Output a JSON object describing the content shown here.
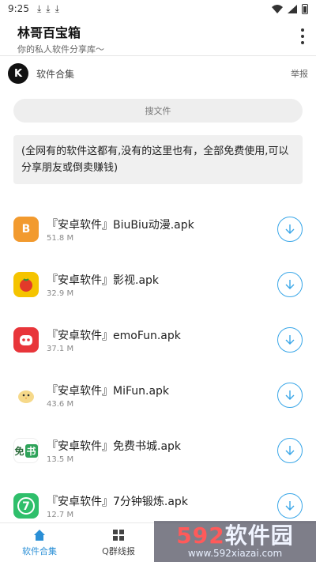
{
  "status": {
    "time": "9:25",
    "download_glyph": "⤓"
  },
  "app": {
    "title": "林哥百宝箱",
    "subtitle": "你的私人软件分享库〜"
  },
  "header": {
    "logo_letter": "K",
    "section_name": "软件合集",
    "report": "举报"
  },
  "search": {
    "placeholder": "搜文件"
  },
  "notice": "(全网有的软件这都有,没有的这里也有，全部免费使用,可以分享朋友或倒卖赚钱)",
  "items": [
    {
      "name": "『安卓软件』BiuBiu动漫.apk",
      "size": "51.8 M",
      "icon": "anime-girl-icon",
      "color": "#f29a2e",
      "glyph": "B"
    },
    {
      "name": "『安卓软件』影视.apk",
      "size": "32.9 M",
      "icon": "tomato-icon",
      "color": "#f5c400",
      "glyph": "●"
    },
    {
      "name": "『安卓软件』emoFun.apk",
      "size": "37.1 M",
      "icon": "emo-face-icon",
      "color": "#e8353a",
      "glyph": "◕"
    },
    {
      "name": "『安卓软件』MiFun.apk",
      "size": "43.6 M",
      "icon": "chick-icon",
      "color": "#f7e3a8",
      "glyph": "◔"
    },
    {
      "name": "『安卓软件』免费书城.apk",
      "size": "13.5 M",
      "icon": "bookstore-icon",
      "color": "#ffffff",
      "glyph": "书"
    },
    {
      "name": "『安卓软件』7分钟锻炼.apk",
      "size": "12.7 M",
      "icon": "seven-icon",
      "color": "#2fbf6b",
      "glyph": "7"
    }
  ],
  "nav": [
    {
      "label": "软件合集",
      "icon": "home-icon",
      "active": true
    },
    {
      "label": "Q群线报",
      "icon": "grid-icon",
      "active": false
    }
  ],
  "watermark": {
    "title_num": "592",
    "title_text": "软件园",
    "url": "www.592xiazai.com"
  },
  "colors": {
    "accent": "#2a8fd6",
    "download_ring": "#3ba7e8"
  }
}
